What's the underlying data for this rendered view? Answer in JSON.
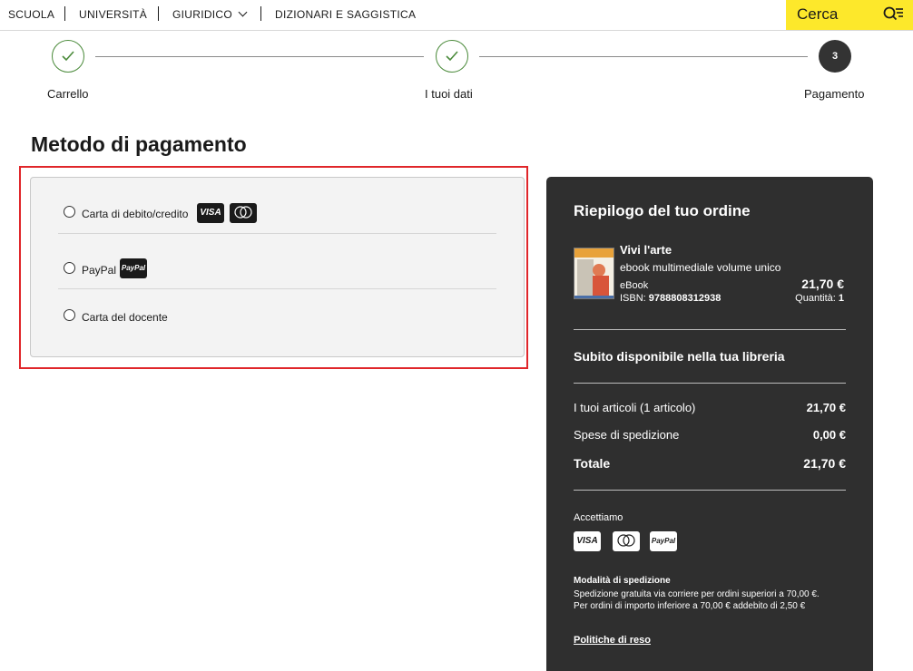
{
  "topnav": {
    "items": [
      "SCUOLA",
      "UNIVERSITÀ",
      "GIURIDICO",
      "DIZIONARI E SAGGISTICA"
    ],
    "search_label": "Cerca",
    "search_bg": "#fde82b"
  },
  "stepper": {
    "steps": [
      {
        "label": "Carrello",
        "state": "done"
      },
      {
        "label": "I tuoi dati",
        "state": "done"
      },
      {
        "label": "Pagamento",
        "state": "active",
        "number": "3"
      }
    ]
  },
  "payment": {
    "title": "Metodo di pagamento",
    "options": [
      {
        "label": "Carta di debito/credito",
        "badges": [
          "VISA",
          "mastercard"
        ],
        "selected": false
      },
      {
        "label": "PayPal",
        "badges": [
          "PayPal"
        ],
        "selected": false
      },
      {
        "label": "Carta del docente",
        "badges": [],
        "selected": false
      }
    ],
    "highlight_color": "#e0262a"
  },
  "summary": {
    "title": "Riepilogo del tuo ordine",
    "product": {
      "name": "Vivi l'arte",
      "subtitle": "ebook multimediale volume unico",
      "format": "eBook",
      "isbn_label": "ISBN:",
      "isbn": "9788808312938",
      "price": "21,70 €",
      "qty_label": "Quantità:",
      "qty": "1"
    },
    "availability": "Subito disponibile nella tua libreria",
    "rows": [
      {
        "label": "I tuoi articoli (1 articolo)",
        "value": "21,70 €"
      },
      {
        "label": "Spese di spedizione",
        "value": "0,00 €"
      }
    ],
    "total_label": "Totale",
    "total_value": "21,70 €",
    "accept_label": "Accettiamo",
    "accept_badges": [
      "VISA",
      "mastercard",
      "PayPal"
    ],
    "shipping_title": "Modalità di spedizione",
    "shipping_lines": [
      "Spedizione gratuita via corriere per ordini superiori a 70,00 €.",
      "Per ordini di importo inferiore a 70,00 € addebito di 2,50 €"
    ],
    "returns_link": "Politiche di reso",
    "panel_bg": "#2f2f2f"
  }
}
